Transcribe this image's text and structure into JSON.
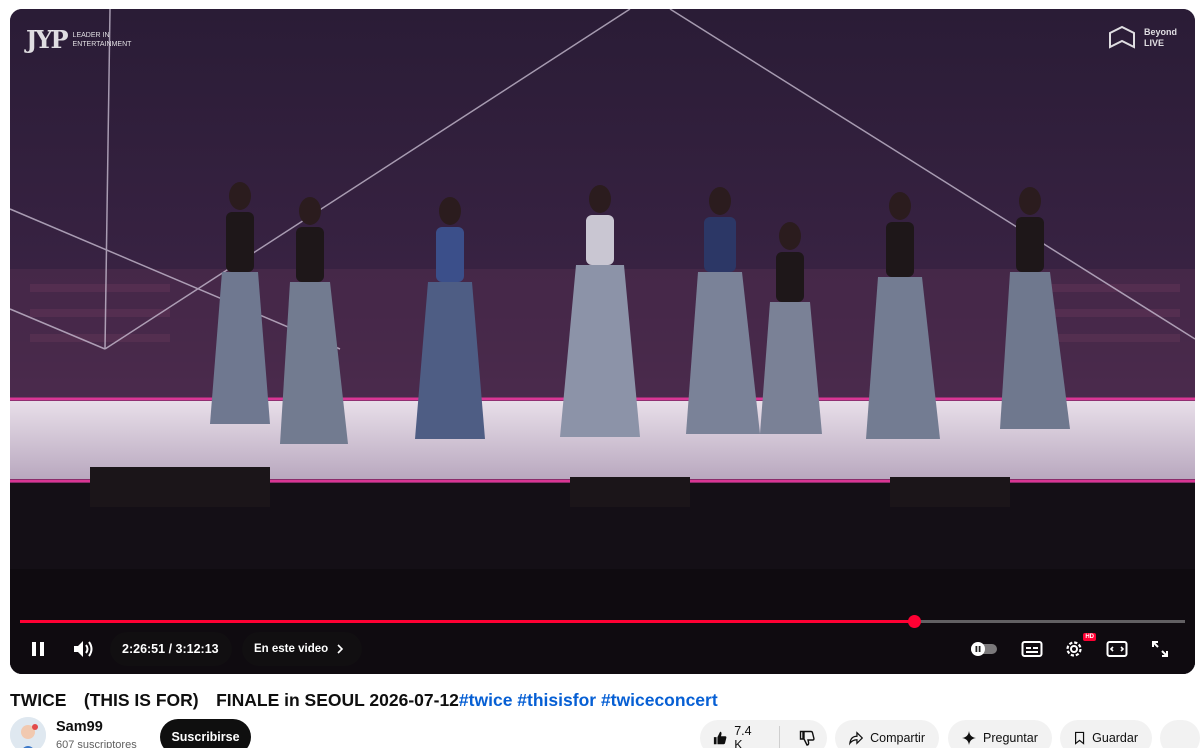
{
  "player": {
    "overlay_logo_left": {
      "mark": "JYP",
      "line1": "LEADER IN",
      "line2": "ENTERTAINMENT"
    },
    "overlay_logo_right": {
      "line1": "Beyond",
      "line2": "LIVE"
    },
    "progress_fraction": 0.767,
    "current_time": "2:26:51",
    "duration": "3:12:13",
    "time_separator": " / ",
    "chapters_label": "En este video",
    "hd_badge": "HD",
    "accent_color": "#ff0033",
    "icons": [
      "pause-icon",
      "volume-icon",
      "chevron-right-icon",
      "autoplay-toggle-icon",
      "captions-icon",
      "settings-icon",
      "theater-mode-icon",
      "fullscreen-icon"
    ]
  },
  "video": {
    "title_text": "TWICE　(THIS IS FOR)　FINALE in SEOUL 2026-07-12",
    "hashtags": [
      "#twice",
      "#thisisfor",
      "#twiceconcert"
    ]
  },
  "channel": {
    "name": "Sam99",
    "subscribers": "607 suscriptores",
    "subscribe_label": "Suscribirse"
  },
  "actions": {
    "likes": "7.4 K",
    "share_label": "Compartir",
    "ask_label": "Preguntar",
    "save_label": "Guardar"
  }
}
